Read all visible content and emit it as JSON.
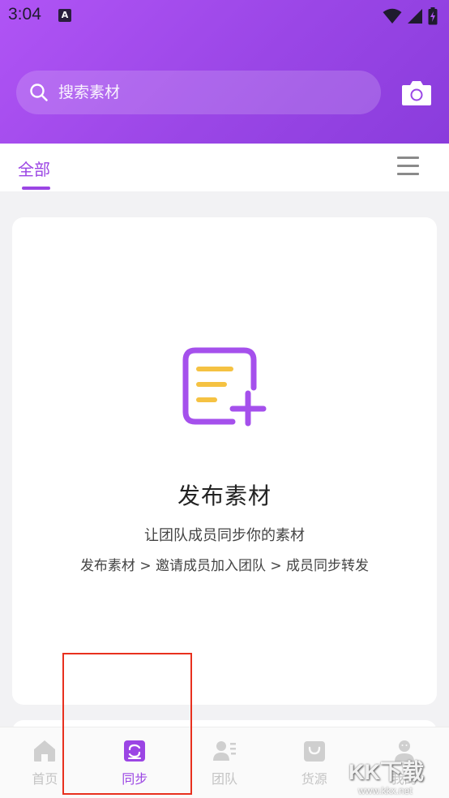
{
  "status_bar": {
    "time": "3:04",
    "app_icon_letter": "A"
  },
  "search": {
    "placeholder": "搜索素材"
  },
  "tabs": {
    "active_label": "全部"
  },
  "card": {
    "title": "发布素材",
    "subtitle": "让团队成员同步你的素材",
    "steps": "发布素材 > 邀请成员加入团队 > 成员同步转发"
  },
  "bottom_nav": {
    "items": [
      {
        "label": "首页",
        "icon": "home-icon",
        "active": false
      },
      {
        "label": "同步",
        "icon": "sync-icon",
        "active": true
      },
      {
        "label": "团队",
        "icon": "team-icon",
        "active": false
      },
      {
        "label": "货源",
        "icon": "shopping-bag-icon",
        "active": false
      },
      {
        "label": "我的",
        "icon": "profile-icon",
        "active": false
      }
    ]
  },
  "watermark": {
    "brand": "KK下载",
    "url": "www.kkx.net"
  },
  "colors": {
    "accent": "#9b45e4",
    "header_start": "#b054f5",
    "header_end": "#8a3cdc",
    "highlight_box": "#e8301e",
    "icon_yellow": "#f5c242"
  }
}
